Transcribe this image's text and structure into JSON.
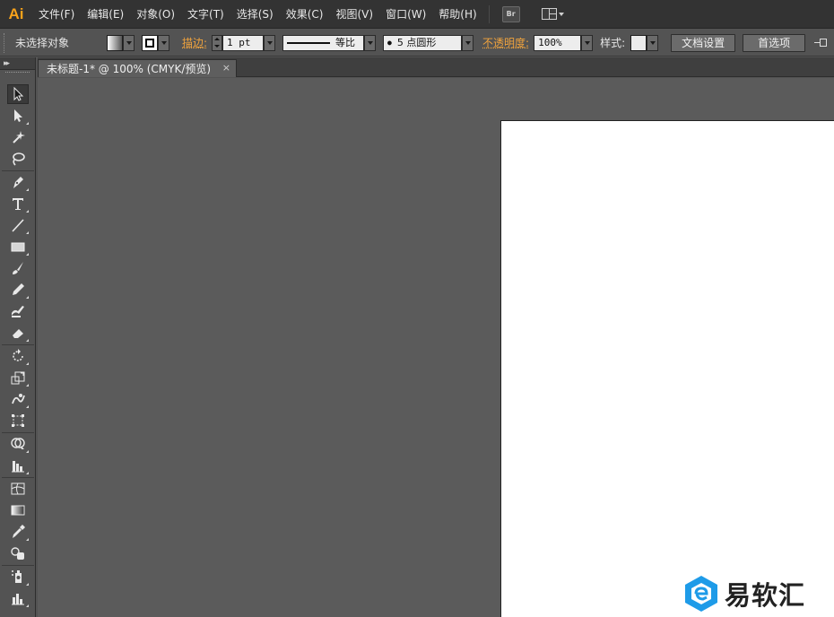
{
  "app": {
    "logo_text": "Ai"
  },
  "menu": [
    "文件(F)",
    "编辑(E)",
    "对象(O)",
    "文字(T)",
    "选择(S)",
    "效果(C)",
    "视图(V)",
    "窗口(W)",
    "帮助(H)"
  ],
  "menubar_extras": {
    "bridge_label": "Br"
  },
  "control": {
    "selection_status": "未选择对象",
    "stroke_label": "描边:",
    "stroke_weight": "1 pt",
    "stroke_profile": "等比",
    "brush_dot": "●",
    "brush": "5 点圆形",
    "opacity_label": "不透明度:",
    "opacity": "100%",
    "style_label": "样式:",
    "doc_setup_btn": "文档设置",
    "prefs_btn": "首选项"
  },
  "document": {
    "tab_title": "未标题-1* @ 100% (CMYK/预览)",
    "tab_close": "×"
  },
  "tools": {
    "collapse_glyph": "▸▸",
    "items": [
      "selection-tool",
      "direct-selection-tool",
      "magic-wand-tool",
      "lasso-tool",
      "pen-tool",
      "type-tool",
      "line-segment-tool",
      "rectangle-tool",
      "paintbrush-tool",
      "pencil-tool",
      "blob-brush-tool",
      "eraser-tool",
      "rotate-tool",
      "scale-tool",
      "warp-tool",
      "free-transform-tool",
      "shape-builder-tool",
      "graph-tool",
      "mesh-tool",
      "gradient-tool",
      "eyedropper-tool",
      "blend-tool",
      "symbol-sprayer-tool",
      "column-graph-tool"
    ]
  },
  "watermark": {
    "text": "易软汇"
  },
  "colors": {
    "accent": "#f7a21b",
    "menubar": "#333333",
    "panel": "#535353",
    "canvas": "#5b5b5b",
    "artboard": "#ffffff",
    "watermark_blue": "#1e9be8"
  }
}
